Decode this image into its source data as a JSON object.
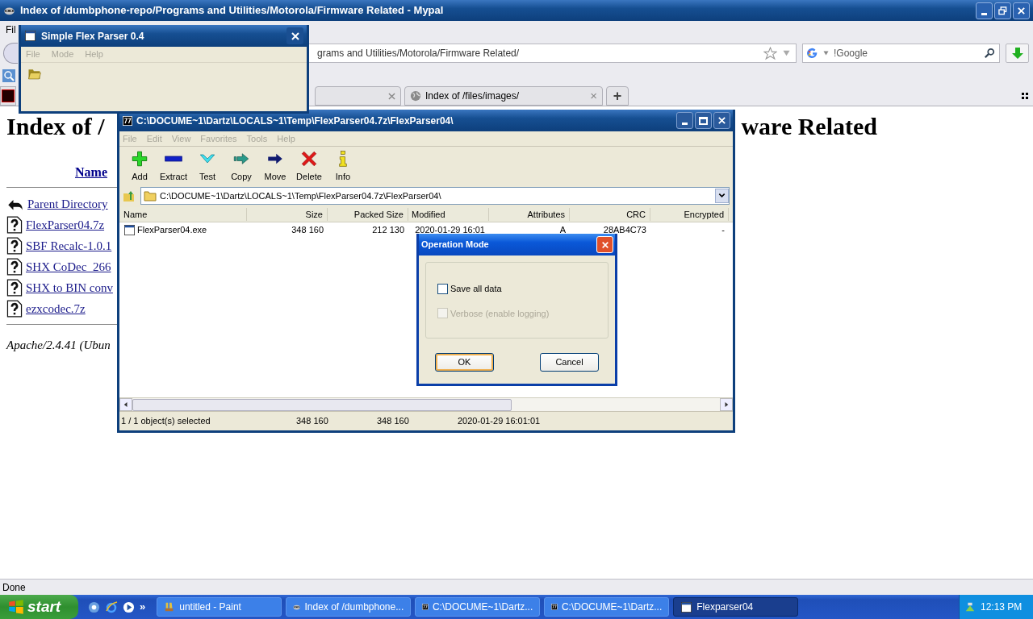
{
  "browser": {
    "title": "Index of /dumbphone-repo/Programs and Utilities/Motorola/Firmware Related - Mypal",
    "menu": [
      "Fil"
    ],
    "address": "grams and Utilities/Motorola/Firmware Related/",
    "search": "!Google",
    "tabs": [
      {
        "label": "Index of /files/images/",
        "close": "×"
      }
    ],
    "new_tab": "+",
    "status": "Done"
  },
  "page": {
    "heading_start": "Index of /",
    "heading_end": "ware Related",
    "column": "Name",
    "entries": [
      {
        "name": "Parent Directory",
        "kind": "parent"
      },
      {
        "name": "FlexParser04.7z",
        "kind": "file"
      },
      {
        "name": "SBF Recalc-1.0.1",
        "kind": "file"
      },
      {
        "name": "SHX CoDec_266",
        "kind": "file"
      },
      {
        "name": "SHX to BIN conv",
        "kind": "file"
      },
      {
        "name": "ezxcodec.7z",
        "kind": "file"
      }
    ],
    "footer": "Apache/2.4.41 (Ubun"
  },
  "flex_parser": {
    "title": "Simple Flex Parser 0.4",
    "menu": [
      {
        "label": "File",
        "disabled": true
      },
      {
        "label": "Mode",
        "disabled": true
      },
      {
        "label": "Help",
        "disabled": true
      }
    ]
  },
  "sevenzip": {
    "title": "C:\\DOCUME~1\\Dartz\\LOCALS~1\\Temp\\FlexParser04.7z\\FlexParser04\\",
    "menu": [
      {
        "label": "File",
        "disabled": true
      },
      {
        "label": "Edit",
        "disabled": true
      },
      {
        "label": "View",
        "disabled": true
      },
      {
        "label": "Favorites",
        "disabled": true
      },
      {
        "label": "Tools",
        "disabled": true
      },
      {
        "label": "Help",
        "disabled": true
      }
    ],
    "toolbar": [
      {
        "label": "Add",
        "kind": "add"
      },
      {
        "label": "Extract",
        "kind": "extract"
      },
      {
        "label": "Test",
        "kind": "test"
      },
      {
        "label": "Copy",
        "kind": "copy"
      },
      {
        "label": "Move",
        "kind": "move"
      },
      {
        "label": "Delete",
        "kind": "delete"
      },
      {
        "label": "Info",
        "kind": "info"
      }
    ],
    "path": "C:\\DOCUME~1\\Dartz\\LOCALS~1\\Temp\\FlexParser04.7z\\FlexParser04\\",
    "columns": [
      "Name",
      "Size",
      "Packed Size",
      "Modified",
      "Attributes",
      "CRC",
      "Encrypted"
    ],
    "rows": [
      [
        "FlexParser04.exe",
        "348 160",
        "212 130",
        "2020-01-29 16:01",
        "A",
        "28AB4C73",
        "-"
      ]
    ],
    "status": [
      "1 / 1 object(s) selected",
      "348 160",
      "348 160",
      "2020-01-29 16:01:01"
    ]
  },
  "dialog": {
    "title": "Operation Mode",
    "options": [
      {
        "label": "Save all data",
        "checked": false,
        "disabled": false
      },
      {
        "label": "Verbose (enable logging)",
        "checked": false,
        "disabled": true
      }
    ],
    "buttons": [
      {
        "label": "OK",
        "default": true
      },
      {
        "label": "Cancel",
        "default": false
      }
    ]
  },
  "taskbar": {
    "start": "start",
    "chevron": "»",
    "tasks": [
      {
        "label": "untitled - Paint",
        "kind": "paint",
        "selected": false
      },
      {
        "label": "Index of /dumbphone...",
        "kind": "browser",
        "selected": false
      },
      {
        "label": "C:\\DOCUME~1\\Dartz...",
        "kind": "archive",
        "selected": false
      },
      {
        "label": "C:\\DOCUME~1\\Dartz...",
        "kind": "archive",
        "selected": false
      },
      {
        "label": "Flexparser04",
        "kind": "app",
        "selected": true
      }
    ],
    "clock": "12:13 PM"
  }
}
